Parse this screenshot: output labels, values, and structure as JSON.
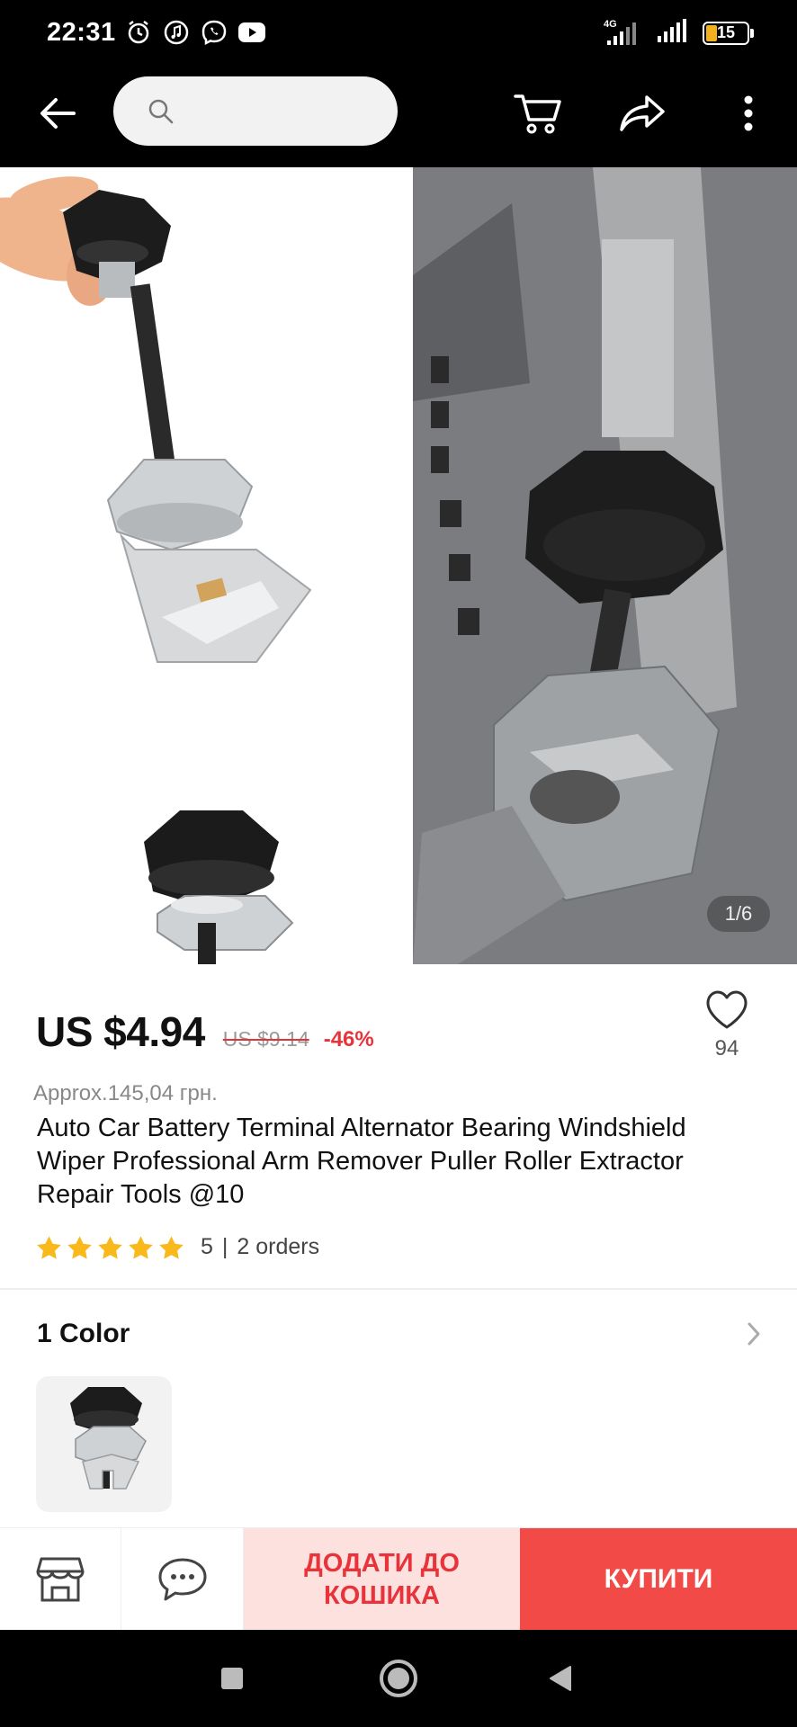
{
  "status_bar": {
    "time": "22:31",
    "network_type": "4G",
    "battery_level": "15",
    "icons": [
      "alarm-icon",
      "music-icon",
      "viber-icon",
      "youtube-icon",
      "signal-icon",
      "signal-icon",
      "battery-icon"
    ]
  },
  "app_bar": {
    "search_placeholder": "",
    "icons": [
      "back-arrow-icon",
      "search-icon",
      "cart-icon",
      "share-icon",
      "more-vertical-icon"
    ]
  },
  "gallery": {
    "page_indicator": "1/6"
  },
  "product": {
    "price": "US $4.94",
    "original_price": "US $9.14",
    "discount": "-46%",
    "wishlist_count": "94",
    "approx_price": "Approx.145,04 грн.",
    "title": "Auto Car Battery Terminal Alternator Bearing Windshield Wiper Professional Arm Remover Puller Roller Extractor Repair Tools @10",
    "rating": "5",
    "rating_separator": "|",
    "orders": "2 orders",
    "rating_stars": 5
  },
  "colors": {
    "title": "1 Color"
  },
  "actions": {
    "add_to_cart": "ДОДАТИ ДО КОШИКА",
    "buy_now": "КУПИТИ",
    "icons": [
      "store-icon",
      "chat-icon"
    ]
  },
  "theme": {
    "accent_red": "#f24a47",
    "discount_red": "#e8333b",
    "add_cart_bg": "#fde1df",
    "star_yellow": "#f9b81c"
  }
}
